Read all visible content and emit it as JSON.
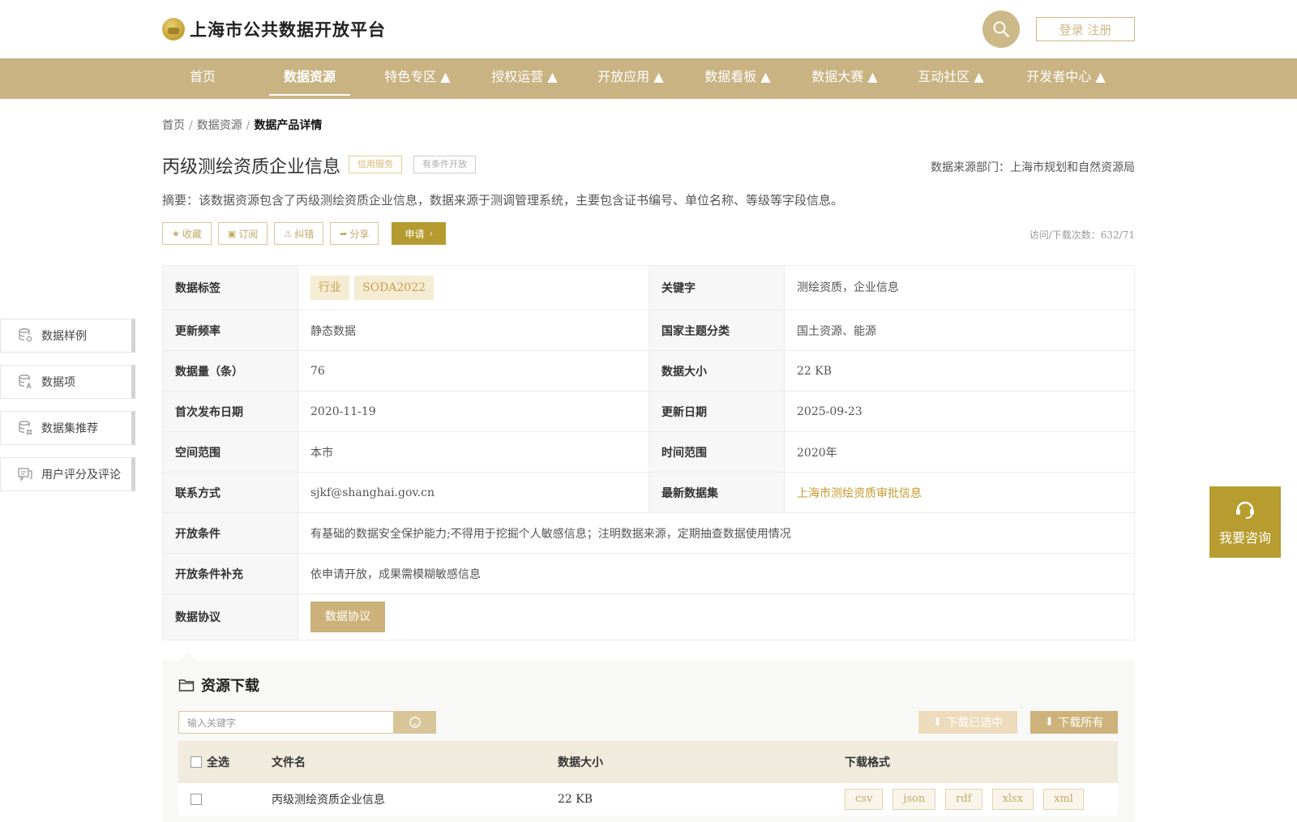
{
  "header": {
    "site_title": "上海市公共数据开放平台",
    "login_label": "登录 注册"
  },
  "nav": {
    "items": [
      "首页",
      "数据资源",
      "特色专区 ▲",
      "授权运营 ▲",
      "开放应用 ▲",
      "数据看板 ▲",
      "数据大赛 ▲",
      "互动社区 ▲",
      "开发者中心 ▲"
    ],
    "active_index": 1
  },
  "breadcrumb": [
    "首页",
    "数据资源",
    "数据产品详情"
  ],
  "dataset": {
    "title": "丙级测绘资质企业信息",
    "badge_service": "信用服务",
    "badge_open": "有条件开放",
    "source": "数据来源部门：上海市规划和自然资源局",
    "abstract": "摘要：该数据资源包含了丙级测绘资质企业信息，数据来源于测调管理系统，主要包含证书编号、单位名称、等级等字段信息。",
    "visits": "访问/下载次数：632/71"
  },
  "actions": {
    "collect": "收藏",
    "subscribe": "订阅",
    "correct": "纠错",
    "share": "分享",
    "apply": "申请"
  },
  "info": {
    "tags_label": "数据标签",
    "tags": [
      "行业",
      "SODA2022"
    ],
    "keywords_label": "关键字",
    "keywords": "测绘资质，企业信息",
    "freq_label": "更新频率",
    "freq": "静态数据",
    "theme_label": "国家主题分类",
    "theme": "国土资源、能源",
    "count_label": "数据量（条）",
    "count": "76",
    "size_label": "数据大小",
    "size": "22 KB",
    "first_label": "首次发布日期",
    "first": "2020-11-19",
    "update_label": "更新日期",
    "update": "2025-09-23",
    "space_label": "空间范围",
    "space": "本市",
    "time_label": "时间范围",
    "time": "2020年",
    "contact_label": "联系方式",
    "contact": "sjkf@shanghai.gov.cn",
    "latest_label": "最新数据集",
    "latest": "上海市测绘资质审批信息",
    "cond_label": "开放条件",
    "cond": "有基础的数据安全保护能力;不得用于挖掘个人敏感信息；注明数据来源，定期抽查数据使用情况",
    "cond_extra_label": "开放条件补充",
    "cond_extra": "依申请开放，成果需模糊敏感信息",
    "agreement_label": "数据协议",
    "agreement_btn": "数据协议"
  },
  "side_tabs": [
    "数据样例",
    "数据项",
    "数据集推荐",
    "用户评分及评论"
  ],
  "consult": "我要咨询",
  "download": {
    "title": "资源下载",
    "search_placeholder": "输入关键字",
    "download_selected": "下载已选中",
    "download_all": "下载所有",
    "col_select_all": "全选",
    "col_filename": "文件名",
    "col_size": "数据大小",
    "col_format": "下载格式",
    "rows": [
      {
        "filename": "丙级测绘资质企业信息",
        "size": "22 KB",
        "formats": [
          "csv",
          "json",
          "rdf",
          "xlsx",
          "xml"
        ]
      }
    ]
  },
  "colors": {
    "nav_bg": "#c9b382",
    "accent": "#b79d2f",
    "gold_text": "#c39a2c"
  }
}
